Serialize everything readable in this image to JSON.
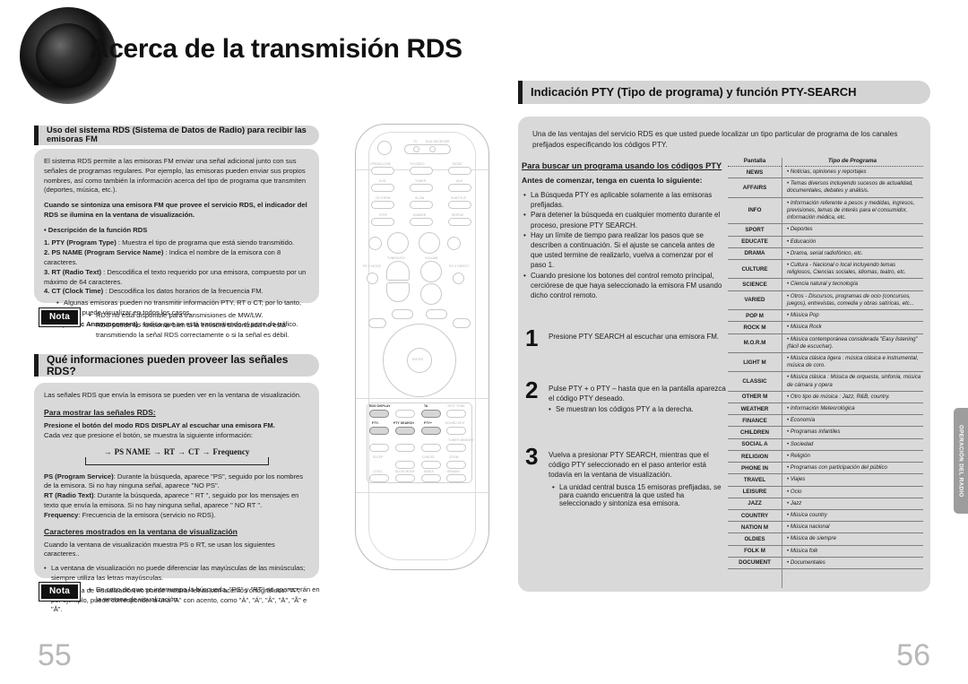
{
  "header": {
    "title": "Acerca de la transmisión RDS",
    "logo": "speaker-logo"
  },
  "left_page": {
    "page_number": "55",
    "section1": {
      "title": "Uso del sistema RDS (Sistema de Datos de Radio) para recibir las emisoras FM",
      "intro": "El sistema RDS permite a las emisoras FM enviar una señal adicional junto con sus señales de programas regulares. Por ejemplo, las emisoras pueden enviar sus propios nombres, así como también la información acerca del tipo de programa que transmiten (deportes, música, etc.).",
      "bold_note": "Cuando se sintoniza una emisora FM que provee el servicio RDS, el indicador del RDS se ilumina en la ventana de visualización.",
      "subhead": "• Descripción de la función RDS",
      "items": [
        {
          "n": "1.",
          "term": "PTY (Program Type)",
          "desc": " : Muestra el tipo de programa que está siendo transmitido."
        },
        {
          "n": "2.",
          "term": "PS NAME (Program Service Name)",
          "desc": " : Indica el nombre de la emisora con 8 caracteres."
        },
        {
          "n": "3.",
          "term": "RT (Radio Text)",
          "desc": " : Descodifica el texto requerido por una emisora, compuesto por un máximo de 64 caracteres."
        },
        {
          "n": "4.",
          "term": "CT (Clock Time)",
          "desc": " : Descodifica los datos horarios de la frecuencia FM."
        }
      ],
      "sub_bullet": "Algunas emisoras pueden no transmitir información PTY, RT o CT; por lo tanto, no se puede visualizar en todos los casos.",
      "item5": {
        "n": "5.",
        "term": "TA (Traffic Announcement)",
        "desc": " : Indica que se está transmitiendo el parte de tráfico."
      }
    },
    "nota1": {
      "label": "Nota",
      "lines": [
        "RDS no está disponible para transmisiones de MW/LW.",
        "RDS puede no funcionar bien si la emisora sintonizada no está transmitiendo la señal RDS correctamente o si la señal es débil."
      ]
    },
    "section2": {
      "title": "Qué informaciones pueden proveer las señales RDS?",
      "intro": "Las señales RDS que envía la emisora se pueden ver en la ventana de visualización.",
      "sub1": "Para mostrar las señales RDS:",
      "bold1": "Presione el botón del modo RDS DISPLAY al escuchar una emisora FM.",
      "line1": "Cada vez que presione el botón, se muestra la siguiente información:",
      "flow": [
        "PS NAME",
        "RT",
        "CT",
        "Frequency"
      ],
      "defs": [
        {
          "term": "PS (Program Service)",
          "desc": ": Durante la búsqueda, aparece \"PS\", seguido por los nombres de la emisora. Si no hay ninguna señal, aparece \"NO PS\"."
        },
        {
          "term": "RT (Radio Text)",
          "desc": ": Durante la búsqueda, aparece \" RT \", seguido por los mensajes en texto que envía la emisora. Si no hay ninguna señal, aparece \" NO RT \"."
        },
        {
          "term": "Frequency",
          "desc": ": Frecuencia de la emisora (servicio no RDS)."
        }
      ],
      "sub2": "Caracteres mostrados en la ventana de visualización",
      "line2": "Cuando la ventana de visualización muestra PS o RT, se usan los siguientes caracteres..",
      "bullets": [
        "La ventana de visualización no puede diferenciar las mayúsculas de las minúsculas; siempre utiliza las letras mayúsculas.",
        "La ventana de visualización no puede mostrar letras con acentos ortográficos. \"A\", por ejemplo, puede corresponder a una \"A\" con acento, como \"À\", \"Á\", \"Â\", \"Ä\", \"Ã\" e \"Å\"."
      ]
    },
    "nota2": {
      "label": "Nota",
      "lines": [
        "En caso de que se interrumpa la búsqueda, \"PS\" y \"RT\" no aparecerán en la ventana de visualización."
      ]
    }
  },
  "remote": {
    "labels_top": [
      "TV",
      "DVD RECEIVER"
    ],
    "buttons": [
      "OPEN/CLOSE",
      "TV/VIDEO",
      "MODE",
      "DVD",
      "TUNER",
      "AUX",
      "CD RIP/W",
      "SLOW",
      "SUBTITLE",
      "STEP",
      "DIMMER",
      "REPEAT",
      "TUNING/CH",
      "VOLUME",
      "P/L II MODE",
      "P/L II DIRECT",
      "ENTER"
    ],
    "highlighted": [
      "RDS DISPLAY",
      "TA",
      "PTY-",
      "PTY SEARCH",
      "PTY+"
    ],
    "keypad_labels": [
      "TEST TONE",
      "SOUND EDIT",
      "TUNER MEMORY",
      "SLEEP",
      "CANCEL",
      "ZOOM",
      "LOGIC",
      "SLIDE MODE",
      "INDEX",
      "REMAIN"
    ]
  },
  "right_page": {
    "page_number": "56",
    "section_title": "Indicación PTY (Tipo de programa) y función PTY-SEARCH",
    "intro": "Una de las ventajas del servicio RDS es que usted puede localizar un tipo particular de programa de los canales prefijados especificando los códigos PTY.",
    "sub_title": "Para buscar un programa usando los códigos PTY",
    "sub_bold": "Antes de comenzar, tenga en cuenta lo siguiente:",
    "bullets": [
      "La Búsqueda PTY es aplicable solamente a las emisoras prefijadas.",
      "Para detener la búsqueda en cualquier momento durante el proceso, presione PTY SEARCH.",
      "Hay un límite de tiempo para realizar los pasos que se describen a continuación. Si el ajuste se cancela antes de que usted termine de realizarlo, vuelva a comenzar por el paso 1.",
      "Cuando presione los botones del control remoto principal, cerciórese de que haya seleccionado la emisora FM usando dicho control remoto."
    ],
    "steps": [
      {
        "num": "1",
        "text": "Presione PTY SEARCH al escuchar una emisora FM.",
        "sub": ""
      },
      {
        "num": "2",
        "text": "Pulse PTY + o PTY – hasta que en la pantalla aparezca el código PTY deseado.",
        "sub": "Se muestran los códigos PTY a la derecha."
      },
      {
        "num": "3",
        "text": "Vuelva a presionar PTY SEARCH, mientras que el código PTY seleccionado en el paso anterior está todavía en la ventana de visualización.",
        "sub": "La unidad central busca 15 emisoras prefijadas, se para cuando encuentra la que usted ha seleccionado y sintoniza esa emisora."
      }
    ],
    "side_tab": "OPERACIÓN DEL RADIO"
  },
  "pty_table": {
    "headers": [
      "Pantalla",
      "Tipo de Programa"
    ],
    "rows": [
      {
        "code": "NEWS",
        "desc": "Noticias, opiniones y reportajes"
      },
      {
        "code": "AFFAIRS",
        "desc": "Temas diversos incluyendo sucesos de actualidad, documentales, debates y análisis."
      },
      {
        "code": "INFO",
        "desc": "Información referente a pesos y medidas, ingresos, previsiones, temas de interés para el consumidor, información médica, etc."
      },
      {
        "code": "SPORT",
        "desc": "Deportes"
      },
      {
        "code": "EDUCATE",
        "desc": "Educación"
      },
      {
        "code": "DRAMA",
        "desc": "Drama, serial radiofónico, etc."
      },
      {
        "code": "CULTURE",
        "desc": "Cultura - Nacional o local incluyendo temas religiosos, Ciencias sociales, idiomas,  teatro, etc."
      },
      {
        "code": "SCIENCE",
        "desc": "Ciencia natural y tecnología"
      },
      {
        "code": "VARIED",
        "desc": "Otros - Discursos, programas de ocio (concursos, juegos), entrevistas, comedia y obras satíricas, etc..."
      },
      {
        "code": "POP M",
        "desc": "Música Pop"
      },
      {
        "code": "ROCK M",
        "desc": "Música Rock"
      },
      {
        "code": "M.O.R.M",
        "desc": "Música contemporánea considerada \"Easy listening\" (fácil de escuchar)."
      },
      {
        "code": "LIGHT M",
        "desc": "Música clásica ligera : música clásica e instrumental, música de coro."
      },
      {
        "code": "CLASSIC",
        "desc": "Música clásica : Música de orquesta, sinfonía, música de cámara y opera"
      },
      {
        "code": "OTHER M",
        "desc": "Otro tipo de música : Jazz, R&B, country."
      },
      {
        "code": "WEATHER",
        "desc": "Información Meteorológica"
      },
      {
        "code": "FINANCE",
        "desc": "Economía"
      },
      {
        "code": "CHILDREN",
        "desc": "Programas infantiles"
      },
      {
        "code": "SOCIAL A",
        "desc": "Sociedad"
      },
      {
        "code": "RELIGION",
        "desc": "Religión"
      },
      {
        "code": "PHONE IN",
        "desc": "Programas con participación del público"
      },
      {
        "code": "TRAVEL",
        "desc": "Viajes"
      },
      {
        "code": "LEISURE",
        "desc": "Ocio"
      },
      {
        "code": "JAZZ",
        "desc": "Jazz"
      },
      {
        "code": "COUNTRY",
        "desc": "Música country"
      },
      {
        "code": "NATION M",
        "desc": "Música nacional"
      },
      {
        "code": "OLDIES",
        "desc": "Música de siempre"
      },
      {
        "code": "FOLK M",
        "desc": "Música folk"
      },
      {
        "code": "DOCUMENT",
        "desc": "Documentales"
      }
    ]
  },
  "colors": {
    "panel": "#d9d9d9",
    "bar": "#d4d4d4",
    "tab": "#9d9d9d",
    "pagenum": "#b8b8b8"
  }
}
